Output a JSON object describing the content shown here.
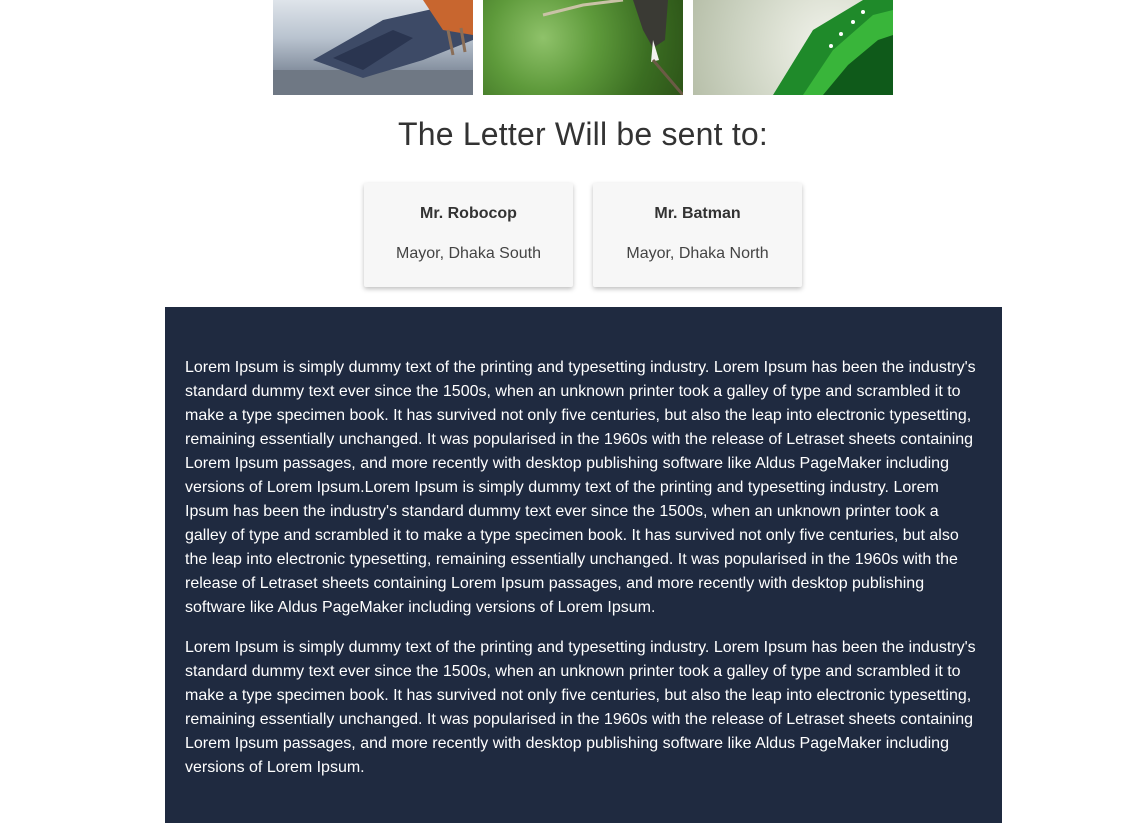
{
  "gallery": {
    "photos": [
      {
        "subject": "bird-blue-orange-photo"
      },
      {
        "subject": "bird-green-foliage-photo"
      },
      {
        "subject": "bird-green-feathers-photo"
      }
    ]
  },
  "heading": "The Letter Will be sent to:",
  "recipients": [
    {
      "name": "Mr. Robocop",
      "role": "Mayor, Dhaka South"
    },
    {
      "name": "Mr. Batman",
      "role": "Mayor, Dhaka North"
    }
  ],
  "content": {
    "paragraphs": [
      "Lorem Ipsum is simply dummy text of the printing and typesetting industry. Lorem Ipsum has been the industry's standard dummy text ever since the 1500s, when an unknown printer took a galley of type and scrambled it to make a type specimen book. It has survived not only five centuries, but also the leap into electronic typesetting, remaining essentially unchanged. It was popularised in the 1960s with the release of Letraset sheets containing Lorem Ipsum passages, and more recently with desktop publishing software like Aldus PageMaker including versions of Lorem Ipsum.Lorem Ipsum is simply dummy text of the printing and typesetting industry. Lorem Ipsum has been the industry's standard dummy text ever since the 1500s, when an unknown printer took a galley of type and scrambled it to make a type specimen book. It has survived not only five centuries, but also the leap into electronic typesetting, remaining essentially unchanged. It was popularised in the 1960s with the release of Letraset sheets containing Lorem Ipsum passages, and more recently with desktop publishing software like Aldus PageMaker including versions of Lorem Ipsum.",
      "Lorem Ipsum is simply dummy text of the printing and typesetting industry. Lorem Ipsum has been the industry's standard dummy text ever since the 1500s, when an unknown printer took a galley of type and scrambled it to make a type specimen book. It has survived not only five centuries, but also the leap into electronic typesetting, remaining essentially unchanged. It was popularised in the 1960s with the release of Letraset sheets containing Lorem Ipsum passages, and more recently with desktop publishing software like Aldus PageMaker including versions of Lorem Ipsum."
    ]
  },
  "colors": {
    "panel_background": "#1f2a40",
    "card_background": "#f7f7f7",
    "heading_text": "#333333"
  }
}
